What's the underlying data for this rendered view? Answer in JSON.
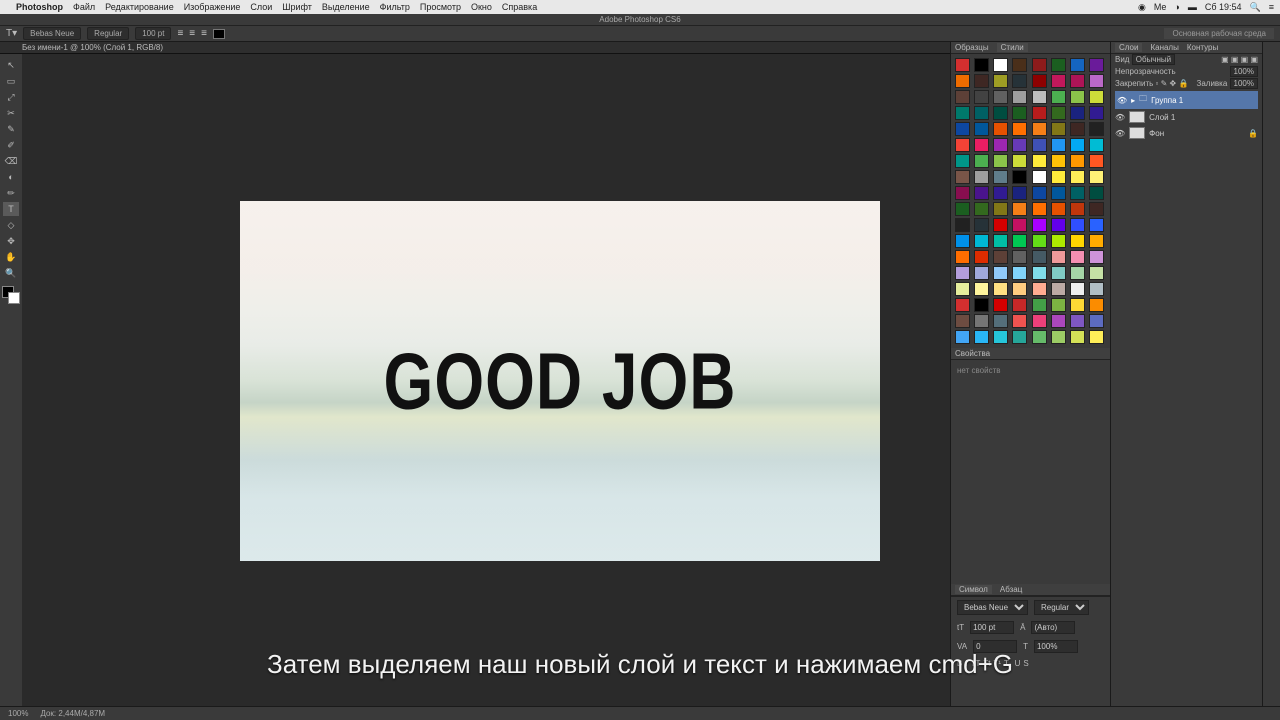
{
  "menubar": {
    "app": "Photoshop",
    "items": [
      "Файл",
      "Редактирование",
      "Изображение",
      "Слои",
      "Шрифт",
      "Выделение",
      "Фильтр",
      "Просмотр",
      "Окно",
      "Справка"
    ],
    "clock": "Сб 19:54",
    "apple": ""
  },
  "titlebar": {
    "title": "Adobe Photoshop CS6"
  },
  "options": {
    "font_family": "Bebas Neue",
    "font_style": "Regular",
    "font_size": "100 pt",
    "right_label": "Основная рабочая среда"
  },
  "tabstrip": {
    "tab": "Без имени-1 @ 100% (Слой 1, RGB/8)"
  },
  "tools": [
    "↖",
    "▭",
    "⤢",
    "✂",
    "✎",
    "✐",
    "⌫",
    "◐",
    "✏",
    "T",
    "◇",
    "✥",
    "✋",
    "🔍"
  ],
  "canvas": {
    "text": "GOOD JOB"
  },
  "swatches": {
    "tabs": [
      "Образцы",
      "Стили"
    ],
    "colors": [
      "#d32f2f",
      "#000000",
      "#ffffff",
      "#4a2f1a",
      "#8d1b1b",
      "#1b5e20",
      "#1565c0",
      "#6a1b9a",
      "#ef6c00",
      "#3e2723",
      "#9e9d24",
      "#263238",
      "#8e0000",
      "#c2185b",
      "#ad1457",
      "#ba68c8",
      "#5d4037",
      "#424242",
      "#616161",
      "#9e9e9e",
      "#bdbdbd",
      "#4caf50",
      "#8bc34a",
      "#cddc39",
      "#00796b",
      "#006064",
      "#004d40",
      "#1b5e20",
      "#b71c1c",
      "#33691e",
      "#1a237e",
      "#311b92",
      "#0d47a1",
      "#01579b",
      "#e65100",
      "#ff6f00",
      "#f57f17",
      "#827717",
      "#3e2723",
      "#212121",
      "#f44336",
      "#e91e63",
      "#9c27b0",
      "#673ab7",
      "#3f51b5",
      "#2196f3",
      "#03a9f4",
      "#00bcd4",
      "#009688",
      "#4caf50",
      "#8bc34a",
      "#cddc39",
      "#ffeb3b",
      "#ffc107",
      "#ff9800",
      "#ff5722",
      "#795548",
      "#9e9e9e",
      "#607d8b",
      "#000000",
      "#ffffff",
      "#ffeb3b",
      "#ffee58",
      "#fff176",
      "#880e4f",
      "#4a148c",
      "#311b92",
      "#1a237e",
      "#0d47a1",
      "#01579b",
      "#006064",
      "#004d40",
      "#1b5e20",
      "#33691e",
      "#827717",
      "#f57f17",
      "#ff6f00",
      "#e65100",
      "#bf360c",
      "#3e2723",
      "#212121",
      "#263238",
      "#d50000",
      "#c51162",
      "#aa00ff",
      "#6200ea",
      "#304ffe",
      "#2962ff",
      "#0091ea",
      "#00b8d4",
      "#00bfa5",
      "#00c853",
      "#64dd17",
      "#aeea00",
      "#ffd600",
      "#ffab00",
      "#ff6d00",
      "#dd2c00",
      "#5d4037",
      "#616161",
      "#455a64",
      "#ef9a9a",
      "#f48fb1",
      "#ce93d8",
      "#b39ddb",
      "#9fa8da",
      "#90caf9",
      "#81d4fa",
      "#80deea",
      "#80cbc4",
      "#a5d6a7",
      "#c5e1a5",
      "#e6ee9c",
      "#fff59d",
      "#ffe082",
      "#ffcc80",
      "#ffab91",
      "#bcaaa4",
      "#eeeeee",
      "#b0bec5",
      "#d32f2f",
      "#000000",
      "#d50000",
      "#c62828",
      "#43a047",
      "#7cb342",
      "#fdd835",
      "#fb8c00",
      "#6d4c41",
      "#757575",
      "#546e7a",
      "#ef5350",
      "#ec407a",
      "#ab47bc",
      "#7e57c2",
      "#5c6bc0",
      "#42a5f5",
      "#29b6f6",
      "#26c6da",
      "#26a69a",
      "#66bb6a",
      "#9ccc65",
      "#d4e157",
      "#ffee58"
    ]
  },
  "properties": {
    "tab": "Свойства",
    "note": "нет свойств"
  },
  "character": {
    "tabs": [
      "Символ",
      "Абзац"
    ],
    "font": "Bebas Neue",
    "style": "Regular",
    "size": "100 pt",
    "leading": "(Авто)",
    "tracking": "0",
    "scale": "100%"
  },
  "layers": {
    "tabs": [
      "Слои",
      "Каналы",
      "Контуры"
    ],
    "blend_label": "Вид",
    "blend_mode": "Обычный",
    "opacity_label": "Непрозрачность",
    "opacity": "100%",
    "lock_label": "Закрепить",
    "fill_label": "Заливка",
    "fill": "100%",
    "items": [
      {
        "name": "Группа 1",
        "selected": true
      },
      {
        "name": "Слой 1",
        "selected": false
      },
      {
        "name": "Фон",
        "selected": false
      }
    ]
  },
  "statusbar": {
    "zoom": "100%",
    "info": "Док: 2,44M/4,87M"
  },
  "subtitle": "Затем выделяем наш новый слой и текст и нажимаем cmd+G"
}
